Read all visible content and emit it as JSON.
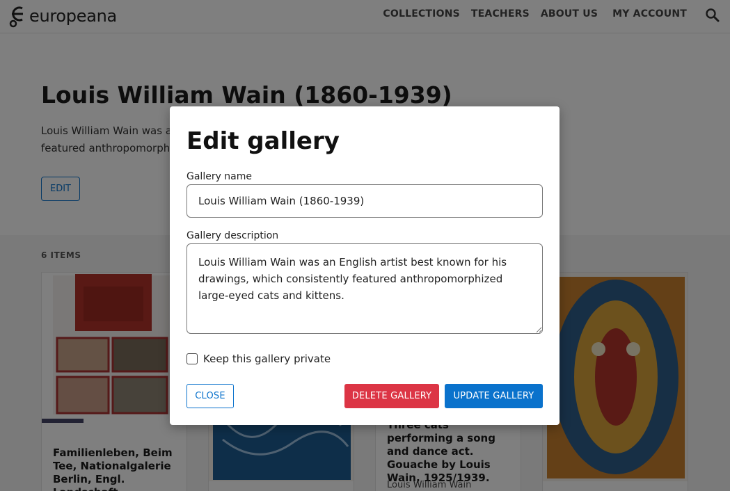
{
  "header": {
    "logo_text": "europeana",
    "nav": [
      "COLLECTIONS",
      "TEACHERS",
      "ABOUT US",
      "MY ACCOUNT"
    ],
    "search_icon": "search-icon"
  },
  "page": {
    "title": "Louis William Wain (1860-1939)",
    "desc_line1": "Louis William Wain was a",
    "desc_line2": "featured anthropomorphi",
    "edit_label": "EDIT",
    "items_count": "6 ITEMS"
  },
  "cards": [
    {
      "title": "Familienleben, Beim Tee, Nationalgalerie Berlin, Engl. Landschaft",
      "subtitle": ""
    },
    {
      "title": "",
      "subtitle": ""
    },
    {
      "title": "Three cats performing a song and dance act. Gouache by Louis Wain, 1925/1939.",
      "subtitle": "Louis William Wain"
    },
    {
      "title": "",
      "subtitle": ""
    }
  ],
  "modal": {
    "title": "Edit gallery",
    "name_label": "Gallery name",
    "name_value": "Louis William Wain (1860-1939)",
    "desc_label": "Gallery description",
    "desc_value": "Louis William Wain was an English artist best known for his drawings, which consistently featured anthropomorphized large-eyed cats and kittens.",
    "private_label": "Keep this gallery private",
    "private_checked": false,
    "close_label": "CLOSE",
    "delete_label": "DELETE GALLERY",
    "update_label": "UPDATE GALLERY"
  },
  "colors": {
    "accent": "#0a72cc",
    "danger": "#dc3545"
  }
}
